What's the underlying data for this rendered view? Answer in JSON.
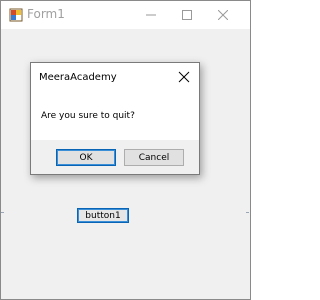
{
  "window": {
    "title": "Form1",
    "controls": {
      "minimize_icon": "minimize-icon",
      "maximize_icon": "maximize-icon",
      "close_icon": "close-icon"
    }
  },
  "form": {
    "button1_label": "button1"
  },
  "messagebox": {
    "title": "MeeraAcademy",
    "message": "Are you sure to quit?",
    "ok_label": "OK",
    "cancel_label": "Cancel"
  },
  "colors": {
    "accent": "#0a64b6",
    "window_bg": "#f0f0f0",
    "dialog_bg": "#ffffff"
  }
}
